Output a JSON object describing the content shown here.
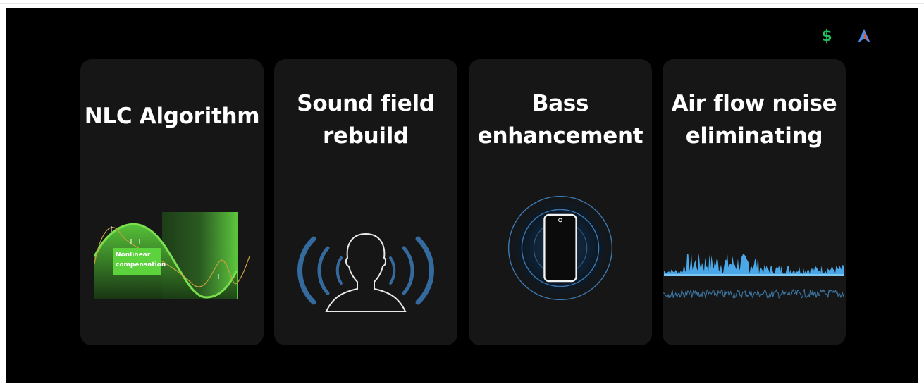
{
  "toolbar": {
    "icons": [
      {
        "name": "dollar-extension-icon",
        "glyph": "$",
        "color": "#1fc25a"
      },
      {
        "name": "arrow-extension-icon",
        "glyph": "A",
        "color": "#4f8be0"
      }
    ]
  },
  "cards": [
    {
      "title_lines": [
        "NLC Algorithm"
      ],
      "label_lines": [
        "Nonlinear",
        "compensation"
      ]
    },
    {
      "title_lines": [
        "Sound field",
        "rebuild"
      ]
    },
    {
      "title_lines": [
        "Bass",
        "enhancement"
      ]
    },
    {
      "title_lines": [
        "Air flow noise",
        "eliminating"
      ]
    }
  ],
  "colors": {
    "background": "#000000",
    "card": "#161616",
    "accent_green": "#5cd33c",
    "accent_blue": "#4aa8e8"
  }
}
